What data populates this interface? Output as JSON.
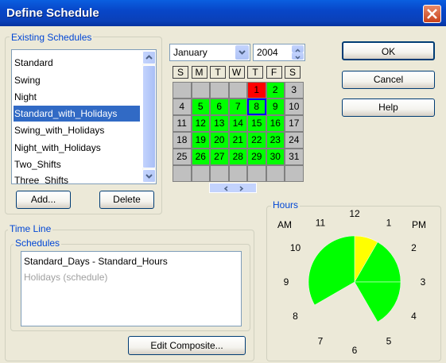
{
  "window": {
    "title": "Define Schedule"
  },
  "existing": {
    "legend": "Existing Schedules",
    "items": [
      "Standard",
      "Swing",
      "Night",
      "Standard_with_Holidays",
      "Swing_with_Holidays",
      "Night_with_Holidays",
      "Two_Shifts",
      "Three_Shifts"
    ],
    "selected_index": 3,
    "add_label": "Add...",
    "delete_label": "Delete"
  },
  "calendar": {
    "month": "January",
    "year": "2004",
    "weekday_headers": [
      "S",
      "M",
      "T",
      "W",
      "T",
      "F",
      "S"
    ],
    "weeks": [
      [
        "",
        "",
        "",
        "",
        "1",
        "2",
        "3"
      ],
      [
        "4",
        "5",
        "6",
        "7",
        "8",
        "9",
        "10"
      ],
      [
        "11",
        "12",
        "13",
        "14",
        "15",
        "16",
        "17"
      ],
      [
        "18",
        "19",
        "20",
        "21",
        "22",
        "23",
        "24"
      ],
      [
        "25",
        "26",
        "27",
        "28",
        "29",
        "30",
        "31"
      ],
      [
        "",
        "",
        "",
        "",
        "",
        "",
        ""
      ]
    ],
    "red_days": [
      "1"
    ],
    "green_days": [
      "2",
      "5",
      "6",
      "7",
      "8",
      "9",
      "12",
      "13",
      "14",
      "15",
      "16",
      "19",
      "20",
      "21",
      "22",
      "23",
      "26",
      "27",
      "28",
      "29",
      "30"
    ],
    "selected_day": "8",
    "colors": {
      "green": "#00FF00",
      "red": "#FF0000",
      "gray": "#C0C0C0",
      "selected_border": "#0000FF"
    }
  },
  "buttons": {
    "ok": "OK",
    "cancel": "Cancel",
    "help": "Help"
  },
  "timeline": {
    "legend": "Time Line",
    "schedules_legend": "Schedules",
    "items": [
      "Standard_Days - Standard_Hours",
      "Holidays (schedule)"
    ],
    "edit_label": "Edit Composite..."
  },
  "hours": {
    "legend": "Hours",
    "am_label": "AM",
    "pm_label": "PM",
    "labels": [
      "12",
      "1",
      "2",
      "3",
      "4",
      "5",
      "6",
      "7",
      "8",
      "9",
      "10",
      "11"
    ],
    "colors": {
      "active": "#00FF00",
      "highlight": "#FFFF00"
    }
  }
}
